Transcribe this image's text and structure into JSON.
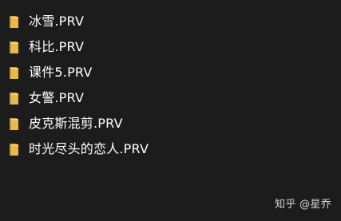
{
  "files": [
    {
      "name": "冰雪.PRV",
      "icon": "folder-icon"
    },
    {
      "name": "科比.PRV",
      "icon": "folder-icon"
    },
    {
      "name": "课件5.PRV",
      "icon": "folder-icon"
    },
    {
      "name": "女警.PRV",
      "icon": "folder-icon"
    },
    {
      "name": "皮克斯混剪.PRV",
      "icon": "folder-icon"
    },
    {
      "name": "时光尽头的恋人.PRV",
      "icon": "folder-icon"
    }
  ],
  "watermark": "知乎 @星乔",
  "colors": {
    "background": "#1c1c1c",
    "text": "#ffffff",
    "folder_front": "#e8b84a",
    "folder_back": "#c99a2e"
  }
}
